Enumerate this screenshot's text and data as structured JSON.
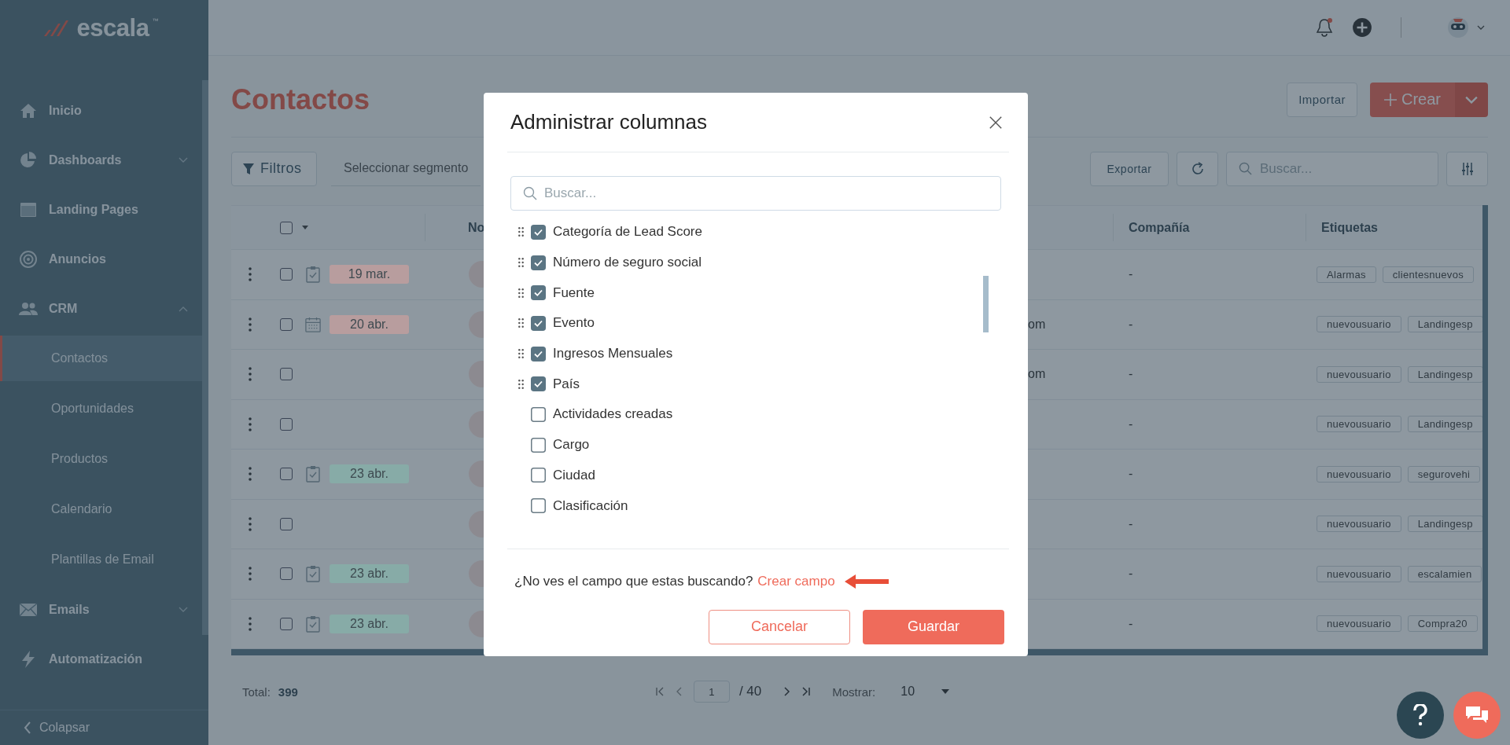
{
  "sidebar": {
    "logo": {
      "name": "escala",
      "mark": "™"
    },
    "items": [
      {
        "label": "Inicio",
        "kind": "home"
      },
      {
        "label": "Dashboards",
        "kind": "dashboards",
        "expanded": false
      },
      {
        "label": "Landing Pages",
        "kind": "pages"
      },
      {
        "label": "Anuncios",
        "kind": "ads"
      },
      {
        "label": "CRM",
        "kind": "crm",
        "expanded": true,
        "children": [
          {
            "label": "Contactos",
            "selected": true
          },
          {
            "label": "Oportunidades",
            "selected": false
          },
          {
            "label": "Productos",
            "selected": false
          },
          {
            "label": "Calendario",
            "selected": false
          },
          {
            "label": "Plantillas de Email",
            "selected": false
          }
        ]
      },
      {
        "label": "Emails",
        "kind": "emails",
        "expanded": false
      },
      {
        "label": "Automatización",
        "kind": "automation"
      }
    ],
    "collapse": "Colapsar"
  },
  "page": {
    "title": "Contactos",
    "import_button": "Importar",
    "create_button": "Crear",
    "filters_button": "Filtros",
    "segment_select": {
      "placeholder": "Seleccionar segmento"
    },
    "export_button": "Exportar",
    "search": {
      "placeholder": "Buscar..."
    }
  },
  "table": {
    "select_all_checked": false,
    "columns": [
      "No",
      "Compañía",
      "Etiquetas"
    ],
    "rows": [
      {
        "kind": "task",
        "checked": false,
        "date": "19 mar.",
        "color": "#b89d9e",
        "company": "-",
        "tags": [
          "Alarmas",
          "clientesnuevos"
        ]
      },
      {
        "kind": "meeting",
        "checked": false,
        "date": "20 abr.",
        "color": "#b89d9e",
        "email": "om",
        "company": "-",
        "tags": [
          "nuevousuario",
          "Landingesp"
        ]
      },
      {
        "kind": "none",
        "checked": false,
        "email": "om",
        "company": "-",
        "tags": [
          "nuevousuario",
          "Landingesp"
        ]
      },
      {
        "kind": "none",
        "checked": false,
        "company": "-",
        "tags": [
          "nuevousuario",
          "Landingesp"
        ]
      },
      {
        "kind": "task",
        "checked": false,
        "date": "23 abr.",
        "color": "#87aba7",
        "company": "-",
        "tags": [
          "nuevousuario",
          "segurovehi"
        ]
      },
      {
        "kind": "none",
        "checked": false,
        "company": "-",
        "tags": [
          "nuevousuario",
          "Landingesp"
        ]
      },
      {
        "kind": "task",
        "checked": false,
        "date": "23 abr.",
        "color": "#87aba7",
        "company": "-",
        "tags": [
          "nuevousuario",
          "escalamien"
        ]
      },
      {
        "kind": "task",
        "checked": false,
        "date": "23 abr.",
        "color": "#87aba7",
        "company": "-",
        "tags": [
          "nuevousuario",
          "Compra20"
        ]
      }
    ]
  },
  "footer": {
    "total_label": "Total:",
    "total": "399",
    "page": "1",
    "pages": "/ 40",
    "show_label": "Mostrar:",
    "show_value": "10"
  },
  "modal": {
    "title": "Administrar columnas",
    "search": {
      "placeholder": "Buscar..."
    },
    "fields": [
      {
        "label": "Categoría de Lead Score",
        "checked": true
      },
      {
        "label": "Número de seguro social",
        "checked": true
      },
      {
        "label": "Fuente",
        "checked": true
      },
      {
        "label": "Evento",
        "checked": true
      },
      {
        "label": "Ingresos Mensuales",
        "checked": true
      },
      {
        "label": "País",
        "checked": true
      },
      {
        "label": "Actividades creadas",
        "checked": false
      },
      {
        "label": "Cargo",
        "checked": false
      },
      {
        "label": "Ciudad",
        "checked": false
      },
      {
        "label": "Clasificación",
        "checked": false
      }
    ],
    "hint": "¿No ves el campo que estas buscando?",
    "link": "Crear campo",
    "cancel_button": "Cancelar",
    "save_button": "Guardar"
  }
}
